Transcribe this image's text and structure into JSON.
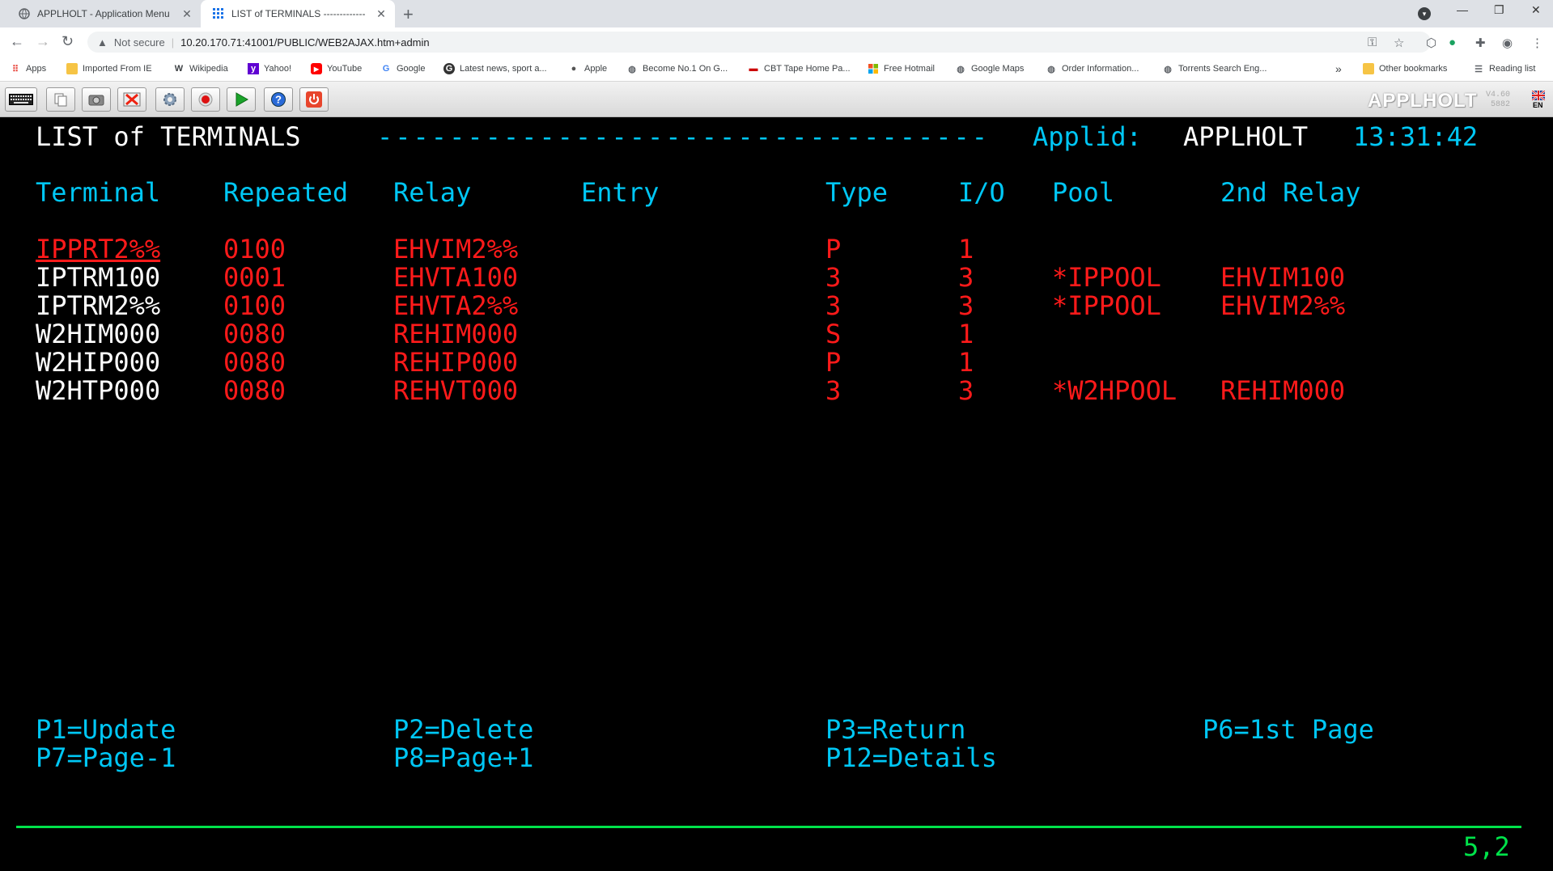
{
  "browser": {
    "tabs": [
      {
        "title": "APPLHOLT - Application Menu",
        "icon": "globe-icon"
      },
      {
        "title": "LIST of TERMINALS -------------",
        "icon": "grid-icon"
      }
    ],
    "not_secure": "Not secure",
    "url": "10.20.170.71:41001/PUBLIC/WEB2AJAX.htm+admin",
    "bookmarks": [
      {
        "label": "Apps",
        "icon": "apps-grid-icon"
      },
      {
        "label": "Imported From IE",
        "icon": "folder-icon"
      },
      {
        "label": "Wikipedia",
        "icon": "wikipedia-icon"
      },
      {
        "label": "Yahoo!",
        "icon": "yahoo-icon"
      },
      {
        "label": "YouTube",
        "icon": "youtube-icon"
      },
      {
        "label": "Google",
        "icon": "google-icon"
      },
      {
        "label": "Latest news, sport a...",
        "icon": "news-icon"
      },
      {
        "label": "Apple",
        "icon": "apple-icon"
      },
      {
        "label": "Become No.1 On G...",
        "icon": "globe-icon"
      },
      {
        "label": "CBT Tape Home Pa...",
        "icon": "cbt-icon"
      },
      {
        "label": "Free Hotmail",
        "icon": "windows-icon"
      },
      {
        "label": "Google Maps",
        "icon": "globe-icon"
      },
      {
        "label": "Order Information...",
        "icon": "globe-icon"
      },
      {
        "label": "Torrents Search Eng...",
        "icon": "globe-icon"
      }
    ],
    "overflow": "»",
    "other_bookmarks": "Other bookmarks",
    "reading_list": "Reading list"
  },
  "emulator": {
    "brand": "APPLHOLT",
    "version": "V4.60",
    "build": "5882",
    "language": "EN",
    "buttons": [
      "keyboard-icon",
      "copy-icon",
      "screenshot-icon",
      "disconnect-icon",
      "settings-gear-icon",
      "record-icon",
      "play-icon",
      "help-icon",
      "power-icon"
    ]
  },
  "screen": {
    "title": "LIST of TERMINALS",
    "dashes": "----------------------------------",
    "applid_label": "Applid:",
    "applid": "APPLHOLT",
    "time": "13:31:42",
    "headers": {
      "terminal": "Terminal",
      "repeated": "Repeated",
      "relay": "Relay",
      "entry": "Entry",
      "type": "Type",
      "io": "I/O",
      "pool": "Pool",
      "relay2": "2nd Relay"
    },
    "rows": [
      {
        "terminal": "IPPRT2%%",
        "repeated": "0100",
        "relay": "EHVIM2%%",
        "type": "P",
        "io": "1",
        "pool": "",
        "relay2": ""
      },
      {
        "terminal": "IPTRM100",
        "repeated": "0001",
        "relay": "EHVTA100",
        "type": "3",
        "io": "3",
        "pool": "*IPPOOL",
        "relay2": "EHVIM100"
      },
      {
        "terminal": "IPTRM2%%",
        "repeated": "0100",
        "relay": "EHVTA2%%",
        "type": "3",
        "io": "3",
        "pool": "*IPPOOL",
        "relay2": "EHVIM2%%"
      },
      {
        "terminal": "W2HIM000",
        "repeated": "0080",
        "relay": "REHIM000",
        "type": "S",
        "io": "1",
        "pool": "",
        "relay2": ""
      },
      {
        "terminal": "W2HIP000",
        "repeated": "0080",
        "relay": "REHIP000",
        "type": "P",
        "io": "1",
        "pool": "",
        "relay2": ""
      },
      {
        "terminal": "W2HTP000",
        "repeated": "0080",
        "relay": "REHVT000",
        "type": "3",
        "io": "3",
        "pool": "*W2HPOOL",
        "relay2": "REHIM000"
      }
    ],
    "pfkeys": {
      "p1": "P1=Update",
      "p2": "P2=Delete",
      "p3": "P3=Return",
      "p6": "P6=1st Page",
      "p7": "P7=Page-1",
      "p8": "P8=Page+1",
      "p12": "P12=Details"
    },
    "cursor_pos": "5,2"
  }
}
